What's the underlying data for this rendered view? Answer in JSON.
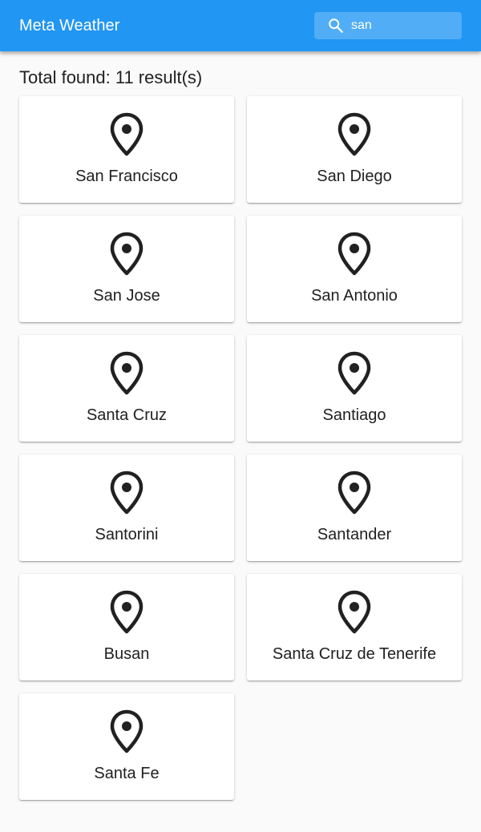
{
  "app_bar": {
    "title": "Meta Weather",
    "search": {
      "value": "san",
      "icon": "search-icon"
    }
  },
  "results": {
    "heading": "Total found: 11 result(s)",
    "items": [
      {
        "label": "San Francisco",
        "icon": "map-pin-icon"
      },
      {
        "label": "San Diego",
        "icon": "map-pin-icon"
      },
      {
        "label": "San Jose",
        "icon": "map-pin-icon"
      },
      {
        "label": "San Antonio",
        "icon": "map-pin-icon"
      },
      {
        "label": "Santa Cruz",
        "icon": "map-pin-icon"
      },
      {
        "label": "Santiago",
        "icon": "map-pin-icon"
      },
      {
        "label": "Santorini",
        "icon": "map-pin-icon"
      },
      {
        "label": "Santander",
        "icon": "map-pin-icon"
      },
      {
        "label": "Busan",
        "icon": "map-pin-icon"
      },
      {
        "label": "Santa Cruz de Tenerife",
        "icon": "map-pin-icon"
      },
      {
        "label": "Santa Fe",
        "icon": "map-pin-icon"
      }
    ]
  },
  "colors": {
    "app_bar": "#2196f3",
    "background": "#fafafa",
    "card": "#ffffff",
    "text": "#212121"
  }
}
